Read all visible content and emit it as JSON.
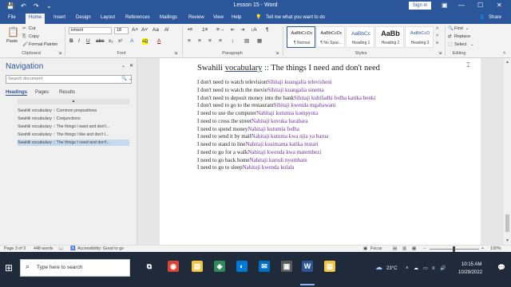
{
  "window": {
    "title": "Lesson 15 - Word",
    "signin_label": "Sign in",
    "quick_access": [
      "💾",
      "↶",
      "↷",
      "⌄"
    ],
    "controls": [
      "—",
      "☐",
      "✕"
    ],
    "restore_glyph": "▣"
  },
  "tabs": {
    "items": [
      "File",
      "Home",
      "Insert",
      "Design",
      "Layout",
      "References",
      "Mailings",
      "Review",
      "View",
      "Help"
    ],
    "tell_me": "Tell me what you want to do",
    "share": "Share",
    "tell_icon": "💡",
    "share_icon": "👤"
  },
  "ribbon": {
    "clipboard": {
      "label": "Clipboard",
      "paste": "Paste",
      "cut": "Cut",
      "copy": "Copy",
      "format_painter": "Format Painter",
      "paste_icon": "📋",
      "cut_icon": "✂",
      "copy_icon": "⎘",
      "painter_icon": "🖌"
    },
    "font": {
      "label": "Font",
      "family": "inherit",
      "size": "18",
      "bold": "B",
      "italic": "I",
      "underline": "U",
      "strike": "abc",
      "sub": "x₂",
      "sup": "x²",
      "grow": "A˄",
      "shrink": "A˅",
      "case": "Aa",
      "clear": "A̸",
      "effects": "A",
      "highlight": "ab̲",
      "color": "A",
      "dropdown": "⌄"
    },
    "paragraph": {
      "label": "Paragraph",
      "top_glyphs": [
        "•≡",
        "1≡",
        "≡→",
        "⇤",
        "⇥",
        "↕A",
        "¶"
      ],
      "bottom_glyphs": [
        "≡",
        "≡",
        "≡",
        "≡",
        "↕",
        "▧",
        "▦"
      ]
    },
    "styles": {
      "label": "Styles",
      "tiles": [
        {
          "sample": "AaBbCcDc",
          "name": "¶ Normal"
        },
        {
          "sample": "AaBbCcDc",
          "name": "¶ No Spac..."
        },
        {
          "sample": "AaBbCc",
          "name": "Heading 1"
        },
        {
          "sample": "AaBb",
          "name": "Heading 2"
        },
        {
          "sample": "AaBbCcD",
          "name": "Heading 3"
        }
      ],
      "scroll_up": "˄",
      "scroll_down": "˅",
      "more": "≡"
    },
    "editing": {
      "label": "Editing",
      "find": "Find",
      "replace": "Replace",
      "select": "Select",
      "find_icon": "🔍",
      "replace_icon": "⇄",
      "select_icon": "⬚",
      "dropdown": "⌄",
      "collapse": "˄"
    },
    "launcher": "⇲"
  },
  "navigation": {
    "title": "Navigation",
    "close_icon": "✕",
    "menu_icon": "⌄",
    "search_placeholder": "Search document",
    "search_icon": "🔍",
    "search_dropdown": "⌄",
    "tabs": [
      "Headings",
      "Pages",
      "Results"
    ],
    "collapse_glyph": "▲",
    "items": [
      "Swahili vocabulary :: Common prepositions",
      "Swahili vocabulary :: Conjunctions",
      "Swahili vocabulary :: The things I want and don't...",
      "Swahili vocabulary :: The things I like and don't l...",
      "Swahili vocabulary :: The things I need and don't..."
    ],
    "selected_index": 4
  },
  "document": {
    "title_pre": "Swahili ",
    "title_link": "vocabulary",
    "title_post": " :: The things I need and don't need",
    "lines": [
      {
        "en": "I don't need to watch television",
        "sw": "Sihitaji kuangalia televisheni"
      },
      {
        "en": "I don't need to watch the movie",
        "sw": "Sihitaji kuangalia sinema"
      },
      {
        "en": "I don't need to deposit money into the bank",
        "sw": "Sihitaji kuhifadhi fedha katika benki"
      },
      {
        "en": "I don't need to go to the restaurant",
        "sw": "Sihitaji kwenda mgahawani"
      },
      {
        "en": "I need to use the computer",
        "sw": "Nahitaji kutumia kompyuta"
      },
      {
        "en": "I need to cross the street",
        "sw": "Nahitaji kuvuka barabara"
      },
      {
        "en": "I need to spend money",
        "sw": "Nahitaji kutumia fedha"
      },
      {
        "en": "I need to send it by mail",
        "sw": "Nahitaji kutuma kwa njia ya barua"
      },
      {
        "en": "I need to stand in line",
        "sw": "Nahitaji kusimama katika mstari"
      },
      {
        "en": "I need to go for a walk",
        "sw": "Nahitaji kwenda kwa matembezi"
      },
      {
        "en": "I need to go back home",
        "sw": "Nahitaji kurudi nyumbani"
      },
      {
        "en": "I need to go to sleep",
        "sw": "Nahitaji kwenda kulala"
      }
    ],
    "cursor": "⌶"
  },
  "scrollbar": {
    "up": "▲",
    "down": "▼"
  },
  "status": {
    "page": "Page 3 of 3",
    "words": "448 words",
    "proof_icon": "📖",
    "accessibility": "Accessibility: Good to go",
    "access_icon": "♿",
    "focus": "Focus",
    "focus_icon": "▣",
    "views": [
      "▤",
      "▥",
      "▦"
    ],
    "zoom_minus": "−",
    "zoom_plus": "+",
    "zoom_level": "100%"
  },
  "taskbar": {
    "start_icon": "⊞",
    "search_text": "Type here to search",
    "search_icon": "⌕",
    "apps": [
      {
        "name": "task-view-icon",
        "glyph": "⧉",
        "color": "#1f2a3a"
      },
      {
        "name": "chrome-icon",
        "glyph": "◉",
        "color": "#db4437"
      },
      {
        "name": "explorer-icon",
        "glyph": "▤",
        "color": "#f4c542"
      },
      {
        "name": "camtasia-icon",
        "glyph": "◆",
        "color": "#2e8b57"
      },
      {
        "name": "edge-icon",
        "glyph": "◐",
        "color": "#0078d7"
      },
      {
        "name": "mail-icon",
        "glyph": "✉",
        "color": "#0072c6"
      },
      {
        "name": "store-icon",
        "glyph": "▣",
        "color": "#5c5c5c"
      },
      {
        "name": "word-icon",
        "glyph": "W",
        "color": "#2b579a"
      },
      {
        "name": "folder-icon",
        "glyph": "▤",
        "color": "#f4c542"
      }
    ],
    "weather_icon": "☁",
    "temperature": "23°C",
    "tray_icons": [
      "˄",
      "☁",
      "▭",
      "≡",
      "🔊"
    ],
    "time": "10:15 AM",
    "date": "10/29/2022",
    "notification_icon": "💬"
  }
}
